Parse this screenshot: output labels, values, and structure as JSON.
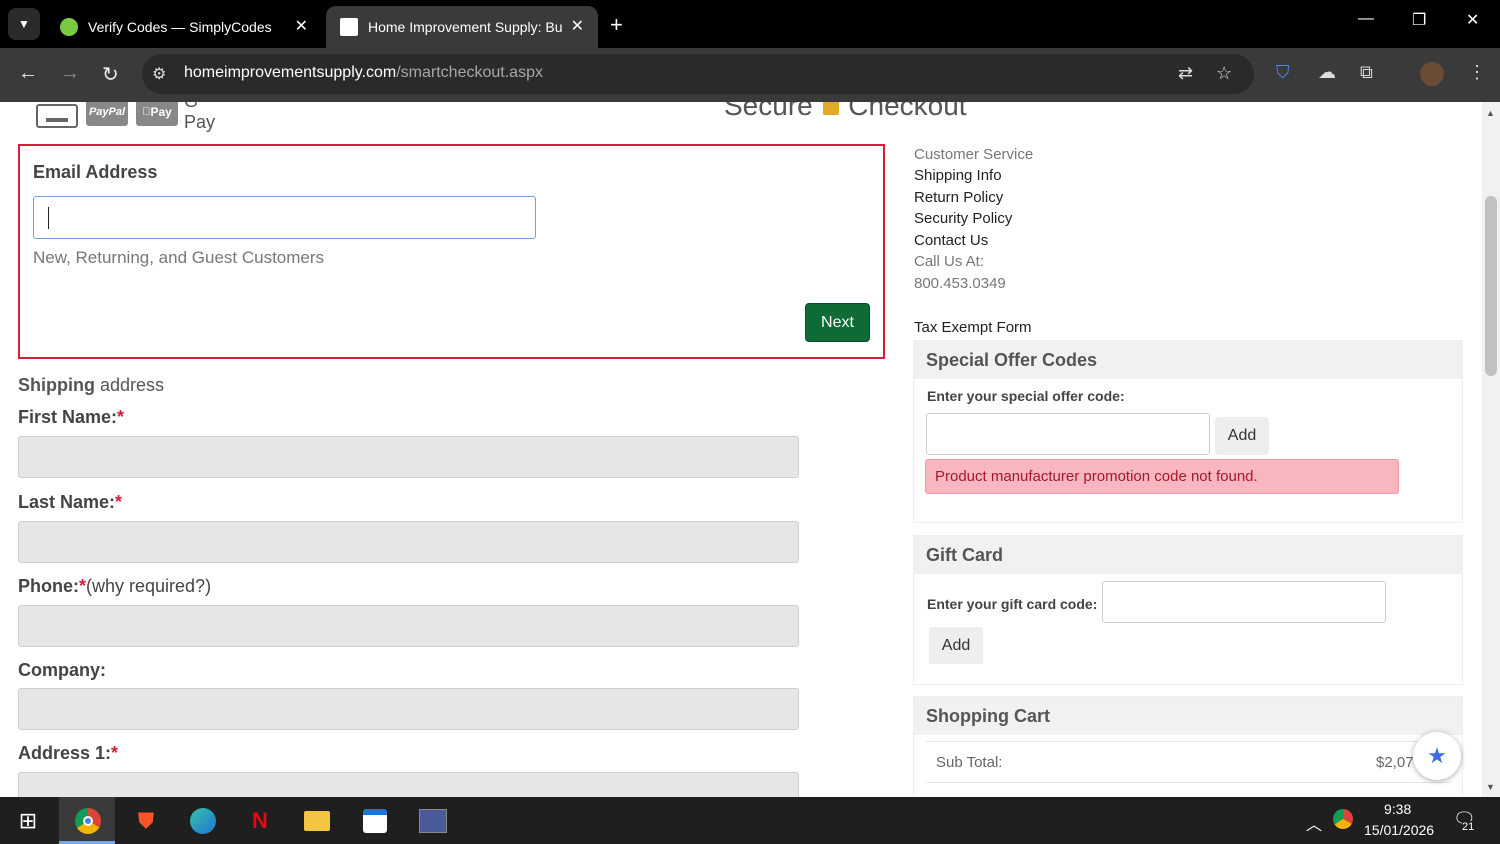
{
  "browser": {
    "tabs": [
      {
        "title": "Verify Codes — SimplyCodes",
        "favicon": "simplycodes-icon"
      },
      {
        "title": "Home Improvement Supply: Bu",
        "favicon": "site-icon"
      }
    ],
    "url_domain": "homeimprovementsupply.com",
    "url_path": "/smartcheckout.aspx"
  },
  "header": {
    "payments": [
      "PayPal",
      "Pay",
      "G Pay"
    ],
    "title_a": "Secure",
    "title_b": "Checkout"
  },
  "email_section": {
    "label": "Email Address",
    "value": "",
    "hint": "New, Returning, and Guest Customers",
    "next_label": "Next"
  },
  "shipping": {
    "heading_bold": "Shipping",
    "heading_rest": " address",
    "fields": [
      {
        "label": "First Name:",
        "required": true
      },
      {
        "label": "Last Name:",
        "required": true
      },
      {
        "label": "Phone:",
        "required": true,
        "note": "(why required?)"
      },
      {
        "label": "Company:",
        "required": false
      },
      {
        "label": "Address 1:",
        "required": true
      }
    ]
  },
  "sidebar": {
    "customer_service": "Customer Service",
    "links": [
      "Shipping Info",
      "Return Policy",
      "Security Policy",
      "Contact Us"
    ],
    "call_us": "Call Us At:",
    "phone": "800.453.0349",
    "tax_form": "Tax Exempt Form"
  },
  "offer": {
    "title": "Special Offer Codes",
    "prompt": "Enter your special offer code:",
    "add_label": "Add",
    "error": "Product manufacturer promotion code not found."
  },
  "gift": {
    "title": "Gift Card",
    "prompt": "Enter your gift card code:",
    "add_label": "Add"
  },
  "cart": {
    "title": "Shopping Cart",
    "subtotal_label": "Sub Total:",
    "subtotal_value": "$2,07"
  },
  "taskbar": {
    "time": "9:38",
    "date": "15/01/2026",
    "notif_count": "21"
  },
  "colors": {
    "accent_green": "#0e6b35",
    "error_red": "#d61f3a",
    "error_bg": "#f8b7bf"
  }
}
